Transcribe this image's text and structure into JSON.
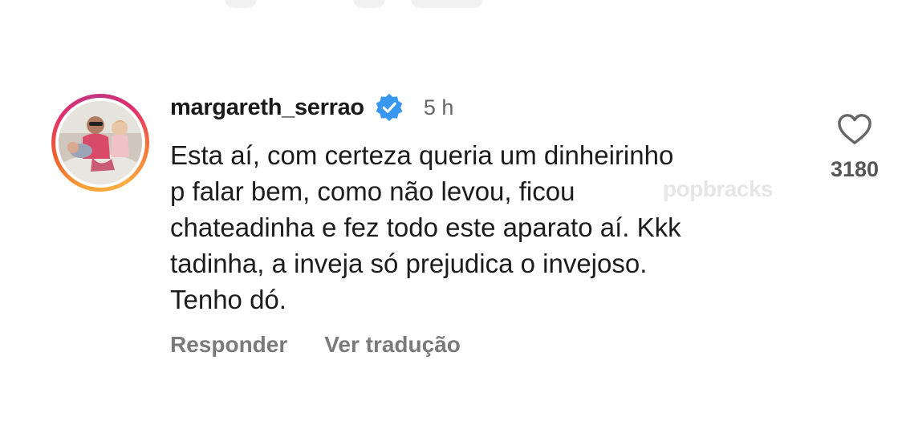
{
  "comment": {
    "username": "margareth_serrao",
    "timestamp": "5 h",
    "text_lines": [
      "Esta aí, com certeza queria um dinheirinho",
      "p falar bem, como não levou, ficou",
      "chateadinha e fez todo este aparato aí. Kkk",
      "tadinha, a inveja só prejudica o invejoso.",
      "Tenho dó."
    ],
    "reply_label": "Responder",
    "translate_label": "Ver tradução",
    "like_count": "3180",
    "verified": true,
    "avatar_ring_colors": [
      "#fcaf45",
      "#f77737",
      "#e1306c",
      "#c13584"
    ],
    "verified_color": "#3897f0"
  },
  "watermark": {
    "text": "popbracks"
  },
  "icons": {
    "like": "heart-icon",
    "verified": "verified-badge-icon",
    "avatar": "avatar-photo"
  }
}
